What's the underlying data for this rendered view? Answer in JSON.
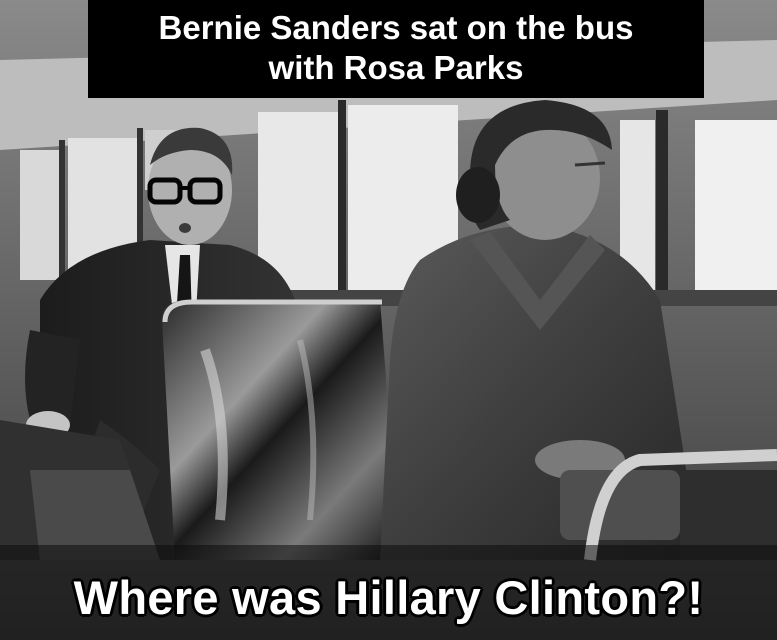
{
  "meme": {
    "top_line_1": "Bernie Sanders sat on the bus",
    "top_line_2": "with Rosa Parks",
    "bottom_text": "Where was Hillary Clinton?!"
  },
  "photo": {
    "style": "black-and-white",
    "palette": {
      "dark": "#141414",
      "mid": "#6a6a6a",
      "light": "#d8d8d8",
      "window": "#eaeaea"
    }
  }
}
